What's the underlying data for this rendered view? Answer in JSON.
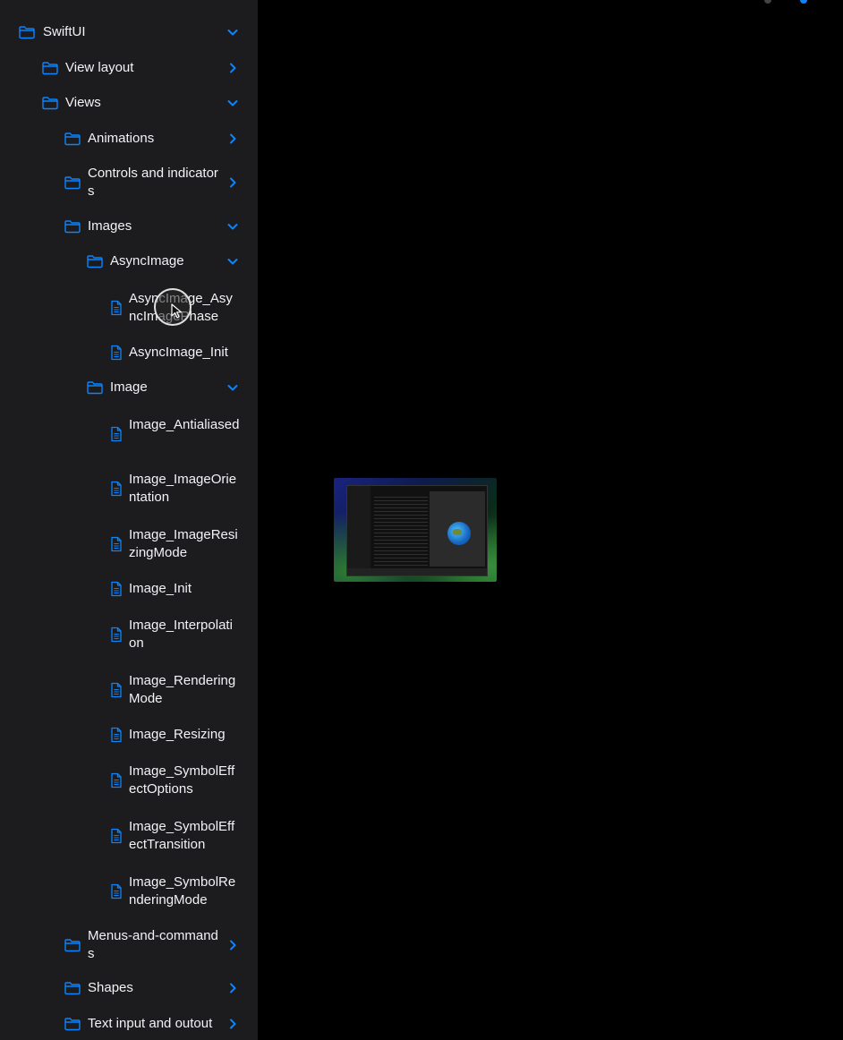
{
  "colors": {
    "accent": "#0a84ff",
    "sidebar_bg": "#1c1c1e",
    "text": "#f2f2f7",
    "detail_bg": "#000000"
  },
  "sidebar": {
    "items": [
      {
        "label": "SwiftUI",
        "type": "folder",
        "expanded": true,
        "icon": "folder-icon"
      },
      {
        "label": "View layout",
        "type": "folder",
        "expanded": false,
        "icon": "folder-icon"
      },
      {
        "label": "Views",
        "type": "folder",
        "expanded": true,
        "icon": "folder-icon"
      },
      {
        "label": "Animations",
        "type": "folder",
        "expanded": false,
        "icon": "folder-icon"
      },
      {
        "label": "Controls and indicators",
        "type": "folder",
        "expanded": false,
        "icon": "folder-icon"
      },
      {
        "label": "Images",
        "type": "folder",
        "expanded": true,
        "icon": "folder-icon"
      },
      {
        "label": "AsyncImage",
        "type": "folder",
        "expanded": true,
        "icon": "folder-icon"
      },
      {
        "label": "AsyncImage_AsyncImagePhase",
        "type": "file",
        "icon": "document-icon"
      },
      {
        "label": "AsyncImage_Init",
        "type": "file",
        "icon": "document-icon"
      },
      {
        "label": "Image",
        "type": "folder",
        "expanded": true,
        "icon": "folder-icon"
      },
      {
        "label": "Image_Antialiased",
        "type": "file",
        "icon": "document-icon"
      },
      {
        "label": "Image_ImageOrientation",
        "type": "file",
        "icon": "document-icon"
      },
      {
        "label": "Image_ImageResizingMode",
        "type": "file",
        "icon": "document-icon"
      },
      {
        "label": "Image_Init",
        "type": "file",
        "icon": "document-icon"
      },
      {
        "label": "Image_Interpolation",
        "type": "file",
        "icon": "document-icon"
      },
      {
        "label": "Image_RenderingMode",
        "type": "file",
        "icon": "document-icon"
      },
      {
        "label": "Image_Resizing",
        "type": "file",
        "icon": "document-icon"
      },
      {
        "label": "Image_SymbolEffectOptions",
        "type": "file",
        "icon": "document-icon"
      },
      {
        "label": "Image_SymbolEffectTransition",
        "type": "file",
        "icon": "document-icon"
      },
      {
        "label": "Image_SymbolRenderingMode",
        "type": "file",
        "icon": "document-icon"
      },
      {
        "label": "Menus-and-commands",
        "type": "folder",
        "expanded": false,
        "icon": "folder-icon"
      },
      {
        "label": "Shapes",
        "type": "folder",
        "expanded": false,
        "icon": "folder-icon"
      },
      {
        "label": "Text input and outout",
        "type": "folder",
        "expanded": false,
        "icon": "folder-icon"
      }
    ]
  },
  "detail": {
    "thumbnail": {
      "icon": "video-preview-thumbnail"
    }
  }
}
